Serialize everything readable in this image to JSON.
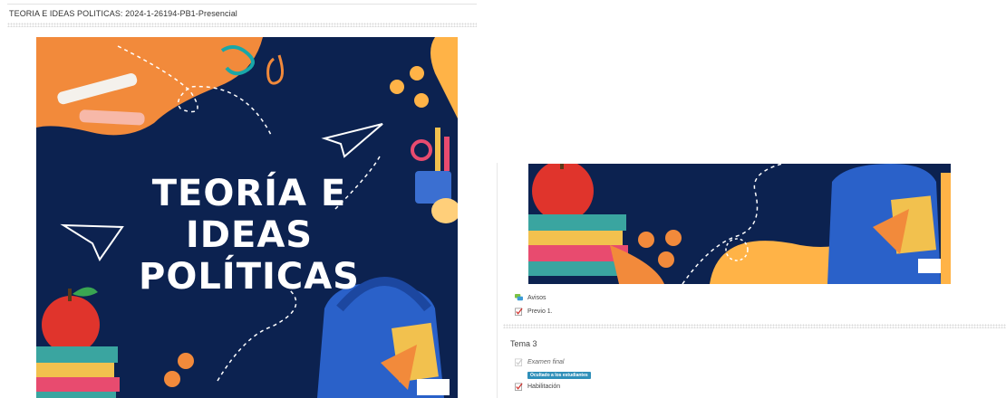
{
  "course": {
    "title": "TEORIA E IDEAS POLITICAS: 2024-1-26194-PB1-Presencial"
  },
  "poster": {
    "title_line1": "TEORÍA E",
    "title_line2": "IDEAS",
    "title_line3": "POLÍTICAS"
  },
  "activities": [
    {
      "label": "Avisos",
      "icon": "forum-icon"
    },
    {
      "label": "Previo 1.",
      "icon": "quiz-icon"
    }
  ],
  "section3": {
    "title": "Tema 3",
    "items": [
      {
        "label": "Examen final",
        "icon": "quiz-icon",
        "badge": "Ocultado a los estudiantes"
      },
      {
        "label": "Habilitación",
        "icon": "quiz-icon"
      }
    ]
  },
  "colors": {
    "navy": "#0c2250",
    "orange": "#f28a3b",
    "yellow": "#ffb347",
    "badge": "#2f8fb9"
  }
}
